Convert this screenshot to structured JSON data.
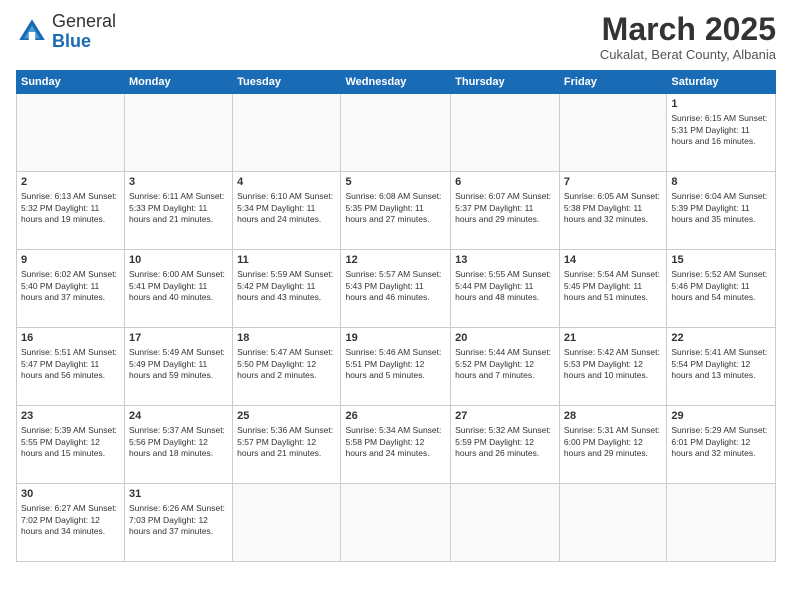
{
  "header": {
    "logo_line1": "General",
    "logo_line2": "Blue",
    "month": "March 2025",
    "location": "Cukalat, Berat County, Albania"
  },
  "weekdays": [
    "Sunday",
    "Monday",
    "Tuesday",
    "Wednesday",
    "Thursday",
    "Friday",
    "Saturday"
  ],
  "weeks": [
    [
      {
        "day": "",
        "info": ""
      },
      {
        "day": "",
        "info": ""
      },
      {
        "day": "",
        "info": ""
      },
      {
        "day": "",
        "info": ""
      },
      {
        "day": "",
        "info": ""
      },
      {
        "day": "",
        "info": ""
      },
      {
        "day": "1",
        "info": "Sunrise: 6:15 AM\nSunset: 5:31 PM\nDaylight: 11 hours and 16 minutes."
      }
    ],
    [
      {
        "day": "2",
        "info": "Sunrise: 6:13 AM\nSunset: 5:32 PM\nDaylight: 11 hours and 19 minutes."
      },
      {
        "day": "3",
        "info": "Sunrise: 6:11 AM\nSunset: 5:33 PM\nDaylight: 11 hours and 21 minutes."
      },
      {
        "day": "4",
        "info": "Sunrise: 6:10 AM\nSunset: 5:34 PM\nDaylight: 11 hours and 24 minutes."
      },
      {
        "day": "5",
        "info": "Sunrise: 6:08 AM\nSunset: 5:35 PM\nDaylight: 11 hours and 27 minutes."
      },
      {
        "day": "6",
        "info": "Sunrise: 6:07 AM\nSunset: 5:37 PM\nDaylight: 11 hours and 29 minutes."
      },
      {
        "day": "7",
        "info": "Sunrise: 6:05 AM\nSunset: 5:38 PM\nDaylight: 11 hours and 32 minutes."
      },
      {
        "day": "8",
        "info": "Sunrise: 6:04 AM\nSunset: 5:39 PM\nDaylight: 11 hours and 35 minutes."
      }
    ],
    [
      {
        "day": "9",
        "info": "Sunrise: 6:02 AM\nSunset: 5:40 PM\nDaylight: 11 hours and 37 minutes."
      },
      {
        "day": "10",
        "info": "Sunrise: 6:00 AM\nSunset: 5:41 PM\nDaylight: 11 hours and 40 minutes."
      },
      {
        "day": "11",
        "info": "Sunrise: 5:59 AM\nSunset: 5:42 PM\nDaylight: 11 hours and 43 minutes."
      },
      {
        "day": "12",
        "info": "Sunrise: 5:57 AM\nSunset: 5:43 PM\nDaylight: 11 hours and 46 minutes."
      },
      {
        "day": "13",
        "info": "Sunrise: 5:55 AM\nSunset: 5:44 PM\nDaylight: 11 hours and 48 minutes."
      },
      {
        "day": "14",
        "info": "Sunrise: 5:54 AM\nSunset: 5:45 PM\nDaylight: 11 hours and 51 minutes."
      },
      {
        "day": "15",
        "info": "Sunrise: 5:52 AM\nSunset: 5:46 PM\nDaylight: 11 hours and 54 minutes."
      }
    ],
    [
      {
        "day": "16",
        "info": "Sunrise: 5:51 AM\nSunset: 5:47 PM\nDaylight: 11 hours and 56 minutes."
      },
      {
        "day": "17",
        "info": "Sunrise: 5:49 AM\nSunset: 5:49 PM\nDaylight: 11 hours and 59 minutes."
      },
      {
        "day": "18",
        "info": "Sunrise: 5:47 AM\nSunset: 5:50 PM\nDaylight: 12 hours and 2 minutes."
      },
      {
        "day": "19",
        "info": "Sunrise: 5:46 AM\nSunset: 5:51 PM\nDaylight: 12 hours and 5 minutes."
      },
      {
        "day": "20",
        "info": "Sunrise: 5:44 AM\nSunset: 5:52 PM\nDaylight: 12 hours and 7 minutes."
      },
      {
        "day": "21",
        "info": "Sunrise: 5:42 AM\nSunset: 5:53 PM\nDaylight: 12 hours and 10 minutes."
      },
      {
        "day": "22",
        "info": "Sunrise: 5:41 AM\nSunset: 5:54 PM\nDaylight: 12 hours and 13 minutes."
      }
    ],
    [
      {
        "day": "23",
        "info": "Sunrise: 5:39 AM\nSunset: 5:55 PM\nDaylight: 12 hours and 15 minutes."
      },
      {
        "day": "24",
        "info": "Sunrise: 5:37 AM\nSunset: 5:56 PM\nDaylight: 12 hours and 18 minutes."
      },
      {
        "day": "25",
        "info": "Sunrise: 5:36 AM\nSunset: 5:57 PM\nDaylight: 12 hours and 21 minutes."
      },
      {
        "day": "26",
        "info": "Sunrise: 5:34 AM\nSunset: 5:58 PM\nDaylight: 12 hours and 24 minutes."
      },
      {
        "day": "27",
        "info": "Sunrise: 5:32 AM\nSunset: 5:59 PM\nDaylight: 12 hours and 26 minutes."
      },
      {
        "day": "28",
        "info": "Sunrise: 5:31 AM\nSunset: 6:00 PM\nDaylight: 12 hours and 29 minutes."
      },
      {
        "day": "29",
        "info": "Sunrise: 5:29 AM\nSunset: 6:01 PM\nDaylight: 12 hours and 32 minutes."
      }
    ],
    [
      {
        "day": "30",
        "info": "Sunrise: 6:27 AM\nSunset: 7:02 PM\nDaylight: 12 hours and 34 minutes."
      },
      {
        "day": "31",
        "info": "Sunrise: 6:26 AM\nSunset: 7:03 PM\nDaylight: 12 hours and 37 minutes."
      },
      {
        "day": "",
        "info": ""
      },
      {
        "day": "",
        "info": ""
      },
      {
        "day": "",
        "info": ""
      },
      {
        "day": "",
        "info": ""
      },
      {
        "day": "",
        "info": ""
      }
    ]
  ]
}
